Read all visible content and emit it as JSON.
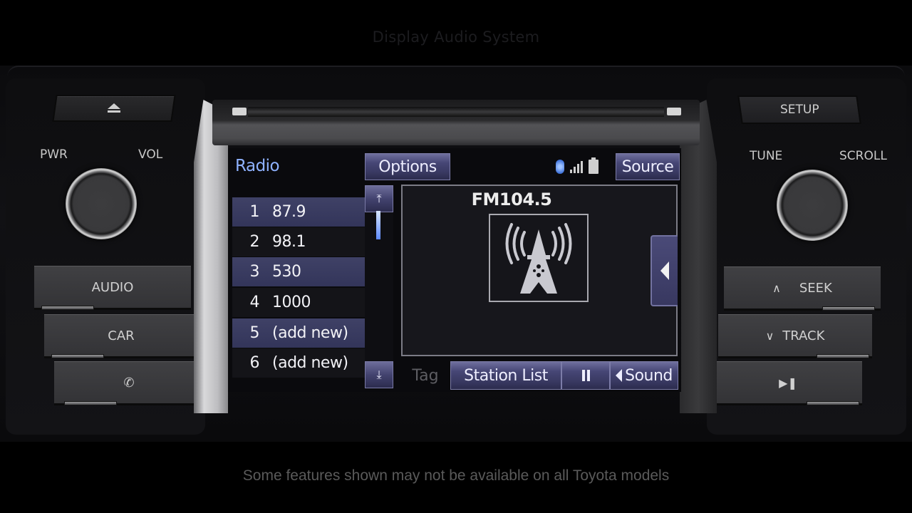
{
  "captions": {
    "top": "Display Audio System",
    "bottom": "Some features shown may not be available on all Toyota models"
  },
  "hardware": {
    "left": {
      "eject_icon": "eject-icon",
      "pwr_label": "PWR",
      "vol_label": "VOL",
      "buttons": [
        {
          "label": "AUDIO"
        },
        {
          "label": "CAR"
        },
        {
          "label": "",
          "icon": "phone-icon"
        }
      ]
    },
    "right": {
      "setup_label": "SETUP",
      "tune_label": "TUNE",
      "scroll_label": "SCROLL",
      "buttons": [
        {
          "label": "SEEK",
          "icon": "chevron-up-icon"
        },
        {
          "label": "TRACK",
          "icon": "chevron-down-icon"
        },
        {
          "label": "",
          "icon": "play-pause-icon"
        }
      ]
    }
  },
  "screen": {
    "title": "Radio",
    "options_label": "Options",
    "source_label": "Source",
    "status_icons": [
      "bluetooth-icon",
      "signal-icon",
      "battery-icon"
    ],
    "presets": [
      {
        "num": "1",
        "freq": "87.9"
      },
      {
        "num": "2",
        "freq": "98.1"
      },
      {
        "num": "3",
        "freq": "530"
      },
      {
        "num": "4",
        "freq": "1000"
      },
      {
        "num": "5",
        "freq": "(add new)"
      },
      {
        "num": "6",
        "freq": "(add new)"
      }
    ],
    "now_playing": {
      "station": "FM104.5",
      "art_icon": "radio-tower-icon"
    },
    "bottom_bar": {
      "tag_label": "Tag",
      "station_list_label": "Station List",
      "pause_icon": "pause-icon",
      "sound_label": "Sound"
    },
    "colors": {
      "title": "#8fb2ff",
      "button": "#464675",
      "preset_highlight": "#3f4166",
      "scroll_thumb": "#5c89ff"
    }
  }
}
